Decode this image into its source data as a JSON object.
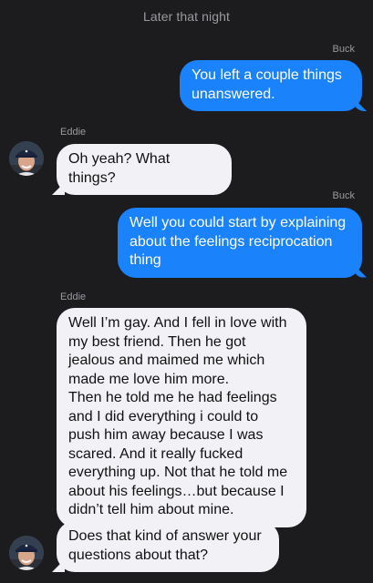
{
  "header": {
    "label": "Later that night"
  },
  "messages": [
    {
      "sender": "Buck",
      "text": "You left a couple things unanswered."
    },
    {
      "sender": "Eddie",
      "text": "Oh yeah? What things?"
    },
    {
      "sender": "Buck",
      "text": "Well you could start by explaining about the feelings reciprocation thing"
    },
    {
      "sender": "Eddie",
      "text": "Well I’m gay. And I fell in love with my best friend. Then he got jealous and maimed me which made me love him more.\nThen he told me he had feelings and I did everything i could to push him away because I was scared. And it really fucked everything up. Not that he told me about his feelings…but because I didn’t tell him about mine."
    },
    {
      "sender": "Eddie",
      "text": "Does that kind of answer your questions about that?"
    }
  ],
  "colors": {
    "background": "#1c1c1e",
    "sent_bubble": "#1a82fb",
    "received_bubble": "#f2f1f6",
    "meta_text": "#9a9a9f"
  },
  "icons": {
    "avatar": "contact-photo-icon"
  }
}
